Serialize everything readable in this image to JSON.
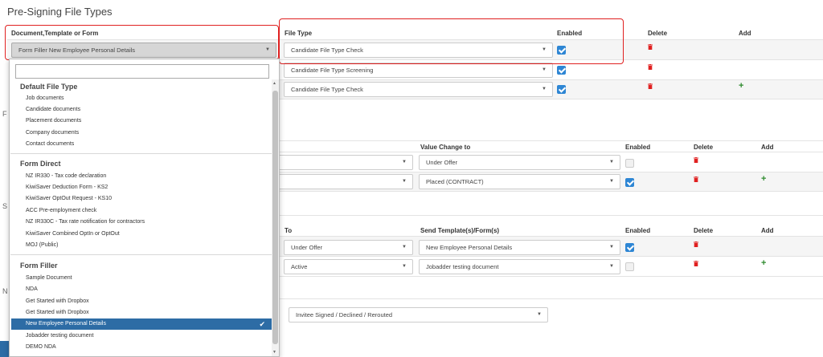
{
  "page": {
    "title": "Pre-Signing File Types"
  },
  "section1": {
    "headers": {
      "doc": "Document,Template or Form",
      "filetype": "File Type",
      "enabled": "Enabled",
      "delete": "Delete",
      "add": "Add"
    },
    "doc_select": "Form Filler New Employee Personal Details",
    "rows": [
      {
        "filetype": "Candidate File Type Check",
        "enabled": true
      },
      {
        "filetype": "Candidate File Type Screening",
        "enabled": true
      },
      {
        "filetype": "Candidate File Type Check",
        "enabled": true
      }
    ]
  },
  "section2": {
    "headers": {
      "value_change": "Value Change to",
      "enabled": "Enabled",
      "delete": "Delete",
      "add": "Add"
    },
    "rows": [
      {
        "value": "Under Offer",
        "enabled": false
      },
      {
        "value": "Placed (CONTRACT)",
        "enabled": true
      }
    ]
  },
  "section3": {
    "headers": {
      "to": "To",
      "send": "Send Template(s)/Form(s)",
      "enabled": "Enabled",
      "delete": "Delete",
      "add": "Add"
    },
    "rows": [
      {
        "to": "Under Offer",
        "send": "New Employee Personal Details",
        "enabled": true
      },
      {
        "to": "Active",
        "send": "Jobadder testing document",
        "enabled": false
      }
    ]
  },
  "section4": {
    "select": "Invitee Signed / Declined / Rerouted"
  },
  "peek_letters": [
    "F",
    "S",
    "N"
  ],
  "dropdown": {
    "search_value": "",
    "groups": [
      {
        "label": "Default File Type",
        "options": [
          "Job documents",
          "Candidate documents",
          "Placement documents",
          "Company documents",
          "Contact documents"
        ]
      },
      {
        "label": "Form Direct",
        "options": [
          "NZ IR330 - Tax code declaration",
          "KiwiSaver Deduction Form - KS2",
          "KiwiSaver OptOut Request - KS10",
          "ACC Pre-employment check",
          "NZ IR330C - Tax rate notification for contractors",
          "KiwiSaver Combined OptIn or OptOut",
          "MOJ (Public)"
        ]
      },
      {
        "label": "Form Filler",
        "options": [
          "Sample Document",
          "NDA",
          "Get Started with Dropbox",
          "Get Started with Dropbox",
          "New Employee Personal Details",
          "Jobadder testing document",
          "DEMO NDA"
        ]
      }
    ],
    "selected": "New Employee Personal Details"
  },
  "colors": {
    "accent": "#2e86d4",
    "highlight": "#2d6ca5",
    "danger": "#e02020",
    "add": "#2e8b2e"
  }
}
